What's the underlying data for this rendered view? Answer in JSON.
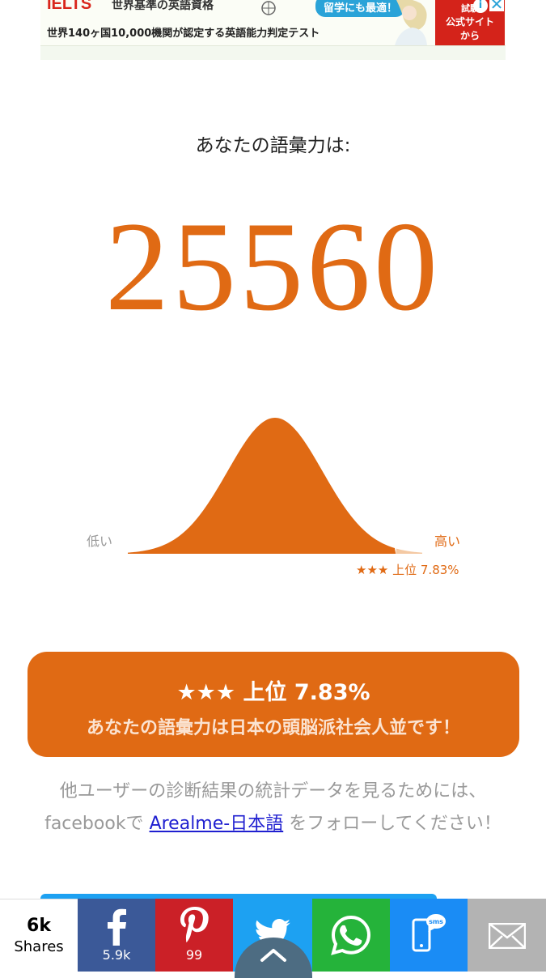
{
  "ad": {
    "brand": "IELTS",
    "tagline": "世界基準の英語資格",
    "badge": "留学にも最適！",
    "text": "世界140ヶ国10,000機関が認定する英語能力判定テスト",
    "cta_line1": "試験",
    "cta_line2": "公式サイト",
    "cta_line3": "から",
    "info_icon": "i",
    "close_icon": "✕"
  },
  "result": {
    "label": "あなたの語彙力は:",
    "score": "25560",
    "low_label": "低い",
    "high_label": "高い",
    "rank_small": "★★★ 上位 7.83%",
    "percentile": 7.83
  },
  "banner": {
    "rank": "★★★ 上位 7.83%",
    "message": "あなたの語彙力は日本の頭脳派社会人並です！"
  },
  "follow": {
    "text_before": "他ユーザーの診断結果の統計データを見るためには、facebookで",
    "link": "Arealme-日本語",
    "text_after": "をフォローしてください！"
  },
  "share": {
    "total": "6k",
    "total_label": "Shares",
    "facebook_count": "5.9k",
    "pinterest_count": "99",
    "colors": {
      "facebook": "#3b5998",
      "pinterest": "#cb2027",
      "twitter": "#1da1f2",
      "whatsapp": "#25b33a",
      "sms": "#1a8cf5",
      "email": "#b3b3b3"
    }
  },
  "colors": {
    "accent": "#e06a14"
  }
}
